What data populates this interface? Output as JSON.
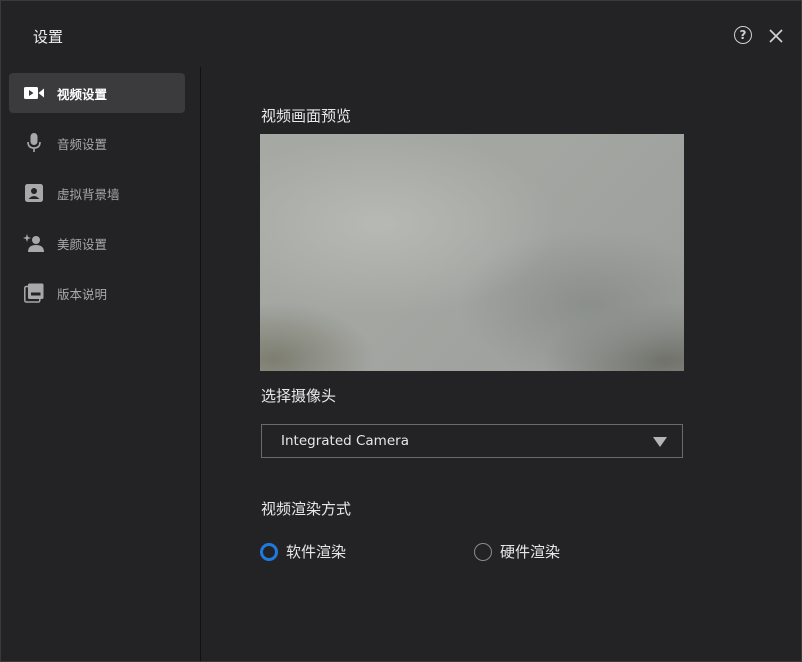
{
  "window": {
    "title": "设置",
    "help_label": "?"
  },
  "sidebar": {
    "items": [
      {
        "label": "视频设置",
        "icon": "video-camera-icon",
        "active": true
      },
      {
        "label": "音频设置",
        "icon": "microphone-icon",
        "active": false
      },
      {
        "label": "虚拟背景墙",
        "icon": "person-portrait-icon",
        "active": false
      },
      {
        "label": "美颜设置",
        "icon": "beauty-sparkle-icon",
        "active": false
      },
      {
        "label": "版本说明",
        "icon": "document-stack-icon",
        "active": false
      }
    ]
  },
  "main": {
    "preview_label": "视频画面预览",
    "camera_label": "选择摄像头",
    "camera_selected": "Integrated Camera",
    "render_label": "视频渲染方式",
    "render_options": [
      {
        "label": "软件渲染",
        "checked": true
      },
      {
        "label": "硬件渲染",
        "checked": false
      }
    ]
  },
  "colors": {
    "accent": "#1f7ae0",
    "background": "#232326",
    "active_item": "#3b3b3e"
  }
}
